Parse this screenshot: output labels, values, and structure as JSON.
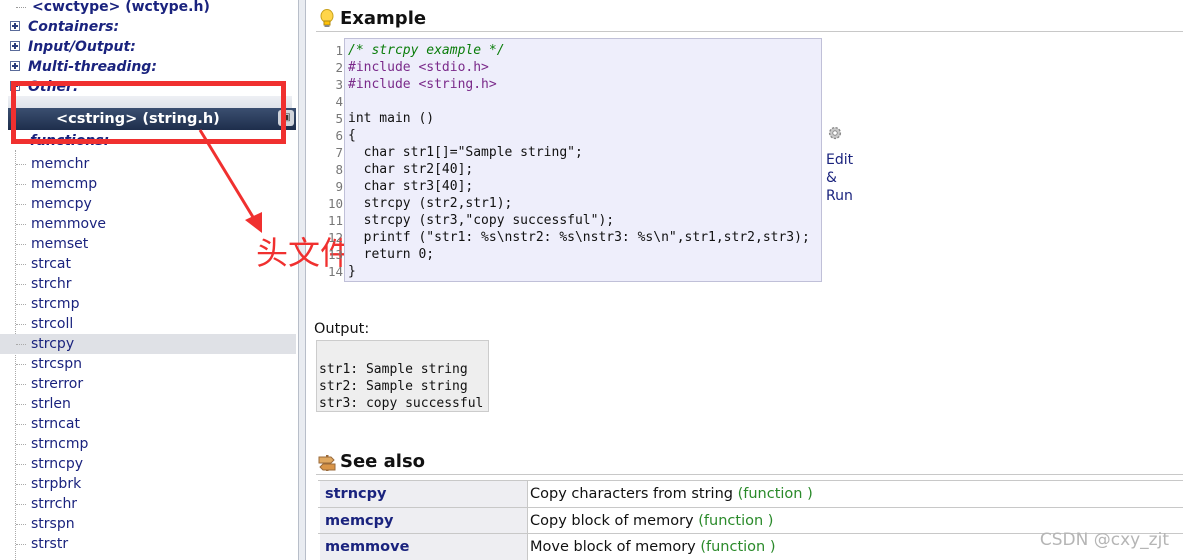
{
  "sidebar": {
    "top_item": "<cwctype> (wctype.h)",
    "categories": [
      "Containers:",
      "Input/Output:",
      "Multi-threading:",
      "Other:"
    ],
    "header": "<cstring> (string.h)",
    "functions_label": "functions:",
    "functions": [
      "memchr",
      "memcmp",
      "memcpy",
      "memmove",
      "memset",
      "strcat",
      "strchr",
      "strcmp",
      "strcoll",
      "strcpy",
      "strcspn",
      "strerror",
      "strlen",
      "strncat",
      "strncmp",
      "strncpy",
      "strpbrk",
      "strrchr",
      "strspn",
      "strstr"
    ],
    "selected": "strcpy"
  },
  "annotation": {
    "text": "头文件",
    "color": "#f0302f"
  },
  "example": {
    "title": "Example",
    "line_numbers": [
      "1",
      "2",
      "3",
      "4",
      "5",
      "6",
      "7",
      "8",
      "9",
      "10",
      "11",
      "12",
      "13",
      "14"
    ],
    "code": [
      "/* strcpy example */",
      "#include <stdio.h>",
      "#include <string.h>",
      "",
      "int main ()",
      "{",
      "  char str1[]=\"Sample string\";",
      "  char str2[40];",
      "  char str3[40];",
      "  strcpy (str2,str1);",
      "  strcpy (str3,\"copy successful\");",
      "  printf (\"str1: %s\\nstr2: %s\\nstr3: %s\\n\",str1,str2,str3);",
      "  return 0;",
      "}"
    ],
    "edit_run": [
      "Edit",
      "&",
      "Run"
    ]
  },
  "output": {
    "label": "Output:",
    "lines": [
      "str1: Sample string",
      "str2: Sample string",
      "str3: copy successful"
    ]
  },
  "see_also": {
    "title": "See also",
    "items": [
      {
        "name": "strncpy",
        "desc": "Copy characters from string",
        "kind": "(function )"
      },
      {
        "name": "memcpy",
        "desc": "Copy block of memory",
        "kind": "(function )"
      },
      {
        "name": "memmove",
        "desc": "Move block of memory",
        "kind": "(function )"
      }
    ]
  },
  "watermark": "CSDN @cxy_zjt"
}
